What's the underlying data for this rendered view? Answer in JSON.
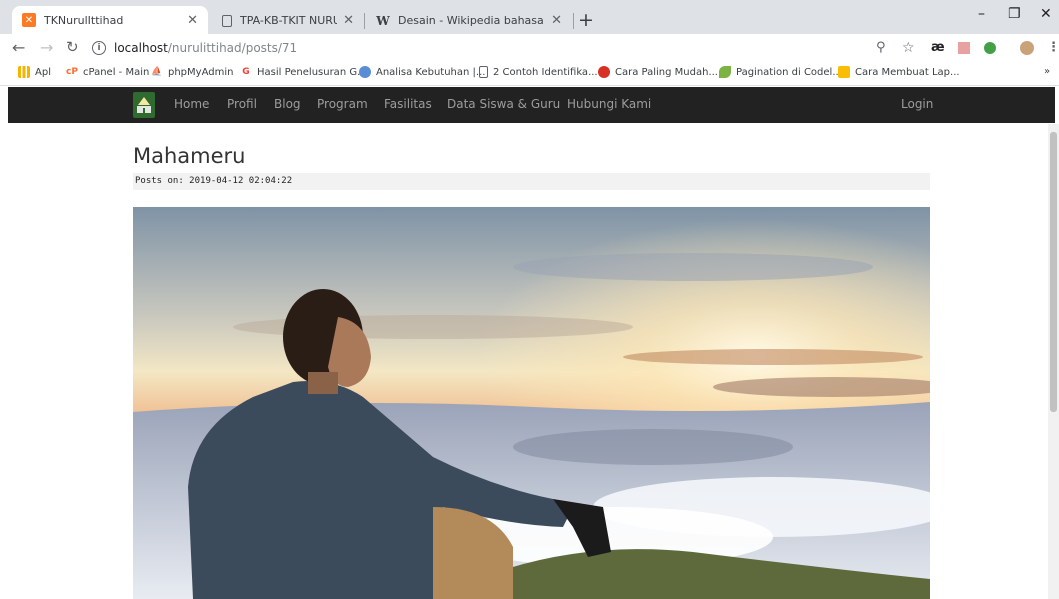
{
  "browser": {
    "tabs": [
      {
        "title": "TKNurulIttihad",
        "favicon": "xampp-icon"
      },
      {
        "title": "TPA-KB-TKIT NURUL ITTIHAD M",
        "favicon": "page-icon"
      },
      {
        "title": "Desain - Wikipedia bahasa Indon",
        "favicon": "wikipedia-icon"
      }
    ],
    "new_tab": "+",
    "window_controls": {
      "minimize": "–",
      "restore": "❐",
      "close": "✕"
    },
    "url": {
      "host": "localhost",
      "path": "/nurulittihad/posts/71"
    },
    "bookmarks": [
      {
        "label": "Apl",
        "icon": "apps-grid-icon",
        "color": "#f4b400"
      },
      {
        "label": "cPanel - Main",
        "icon": "cpanel-icon",
        "color": "#ff6c2c"
      },
      {
        "label": "phpMyAdmin",
        "icon": "phpmyadmin-icon",
        "color": "#f89c0e"
      },
      {
        "label": "Hasil Penelusuran G...",
        "icon": "google-icon",
        "color": "#ea4335"
      },
      {
        "label": "Analisa Kebutuhan |...",
        "icon": "globe-icon",
        "color": "#5b8dd6"
      },
      {
        "label": "2 Contoh Identifika...",
        "icon": "page-icon",
        "color": "#5f6368"
      },
      {
        "label": "Cara Paling Mudah...",
        "icon": "site-icon",
        "color": "#d93025"
      },
      {
        "label": "Pagination di Codel...",
        "icon": "leaf-icon",
        "color": "#7cb342"
      },
      {
        "label": "Cara Membuat Lap...",
        "icon": "site-icon",
        "color": "#fbbc04"
      }
    ],
    "bookmarks_more": "»"
  },
  "site": {
    "nav": [
      "Home",
      "Profil",
      "Blog",
      "Program",
      "Fasilitas",
      "Data Siswa & Guru",
      "Hubungi Kami"
    ],
    "login": "Login"
  },
  "post": {
    "title": "Mahameru",
    "meta": "Posts on: 2019-04-12 02:04:22"
  },
  "colors": {
    "navbar_bg": "#222222",
    "nav_text": "#9d9d9d",
    "tabstrip_bg": "#dee1e6"
  }
}
